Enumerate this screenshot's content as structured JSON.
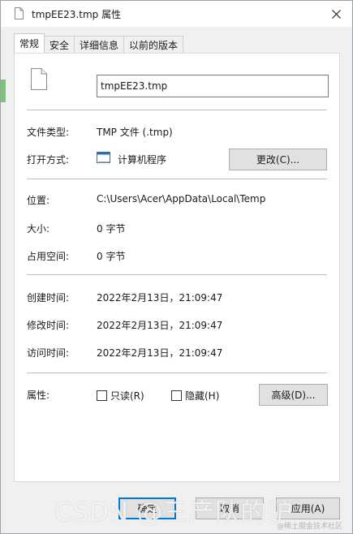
{
  "window": {
    "title": "tmpEE23.tmp 属性",
    "close_icon": "close-icon"
  },
  "tabs": [
    {
      "label": "常规",
      "active": true
    },
    {
      "label": "安全",
      "active": false
    },
    {
      "label": "详细信息",
      "active": false
    },
    {
      "label": "以前的版本",
      "active": false
    }
  ],
  "general": {
    "file_name": "tmpEE23.tmp",
    "file_type_label": "文件类型:",
    "file_type_value": "TMP 文件 (.tmp)",
    "open_with_label": "打开方式:",
    "open_with_value": "计算机程序",
    "change_button": "更改(C)...",
    "location_label": "位置:",
    "location_value": "C:\\Users\\Acer\\AppData\\Local\\Temp",
    "size_label": "大小:",
    "size_value": "0 字节",
    "size_on_disk_label": "占用空间:",
    "size_on_disk_value": "0 字节",
    "created_label": "创建时间:",
    "created_value": "2022年2月13日，21:09:47",
    "modified_label": "修改时间:",
    "modified_value": "2022年2月13日，21:09:47",
    "accessed_label": "访问时间:",
    "accessed_value": "2022年2月13日，21:09:47",
    "attributes_label": "属性:",
    "readonly_label": "只读(R)",
    "hidden_label": "隐藏(H)",
    "advanced_button": "高级(D)..."
  },
  "footer": {
    "ok_button": "确定",
    "cancel_button": "取消",
    "apply_button": "应用(A)"
  },
  "watermark": {
    "text": "CSDN @三产队的驴",
    "sub_text": "@稀土掘金技术社区"
  },
  "colors": {
    "accent": "#0078d7",
    "panel_bg": "#ffffff",
    "window_bg": "#f0f0f0"
  }
}
